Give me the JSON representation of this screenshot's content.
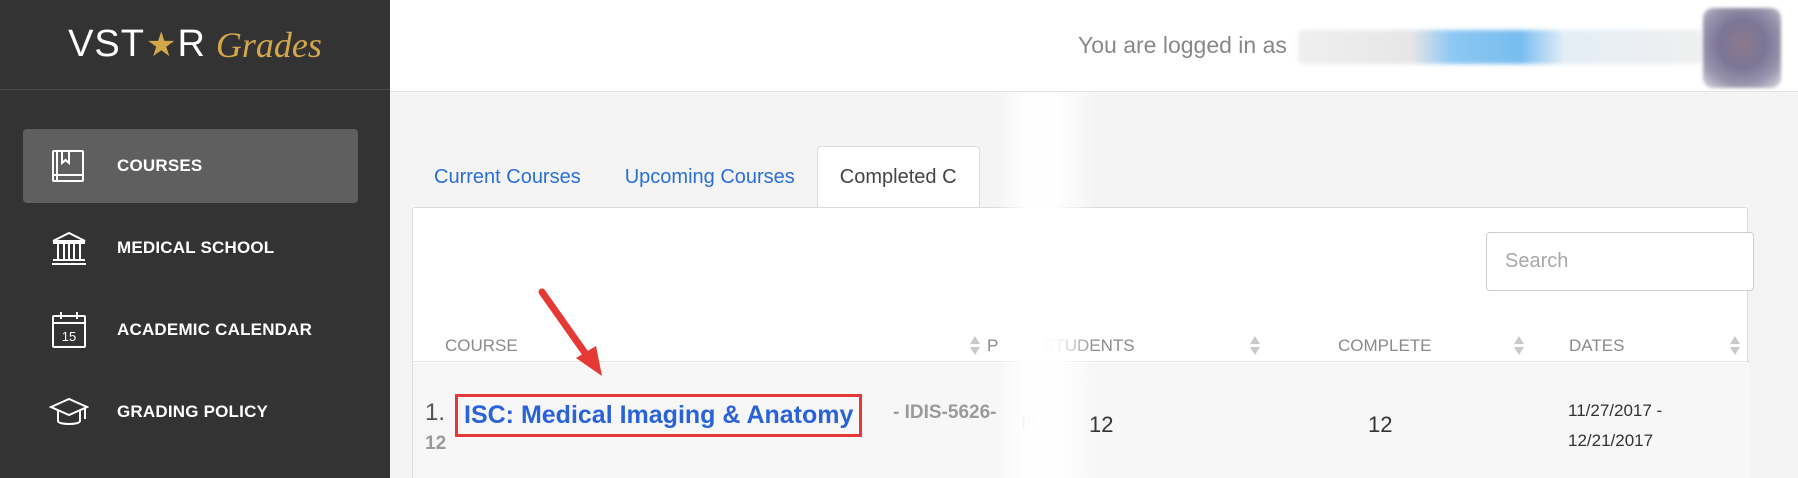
{
  "app": {
    "logo_main_left": "VST",
    "logo_star": "★",
    "logo_main_right": "R",
    "logo_script": "Grades"
  },
  "sidebar": {
    "items": [
      {
        "label": "COURSES",
        "icon": "book-icon",
        "active": true
      },
      {
        "label": "MEDICAL SCHOOL",
        "icon": "building-columns-icon",
        "active": false
      },
      {
        "label": "ACADEMIC CALENDAR",
        "icon": "calendar-icon",
        "active": false,
        "icon_text": "15"
      },
      {
        "label": "GRADING POLICY",
        "icon": "graduation-cap-icon",
        "active": false
      }
    ]
  },
  "header": {
    "logged_in_text": "You are logged in as"
  },
  "tabs": [
    {
      "label": "Current Courses",
      "active": false
    },
    {
      "label": "Upcoming Courses",
      "active": false
    },
    {
      "label": "Completed C",
      "active": true
    }
  ],
  "search": {
    "placeholder": "Search"
  },
  "table": {
    "columns": [
      "COURSE",
      "P",
      "STUDENTS",
      "COMPLETE",
      "DATES"
    ],
    "rows": [
      {
        "index": "1.",
        "course_title": "ISC: Medical Imaging & Anatomy",
        "course_code_line1": "- IDIS-5626-",
        "course_code_line2": "12",
        "partial": "In",
        "students": "12",
        "complete": "12",
        "dates_line1": "11/27/2017 -",
        "dates_line2": "12/21/2017"
      }
    ]
  },
  "colors": {
    "sidebar_bg": "#333333",
    "active_item_bg": "#5f5f5f",
    "brand_gold": "#d3a84b",
    "link_blue": "#2a63d9",
    "annotation_red": "#e53935"
  }
}
